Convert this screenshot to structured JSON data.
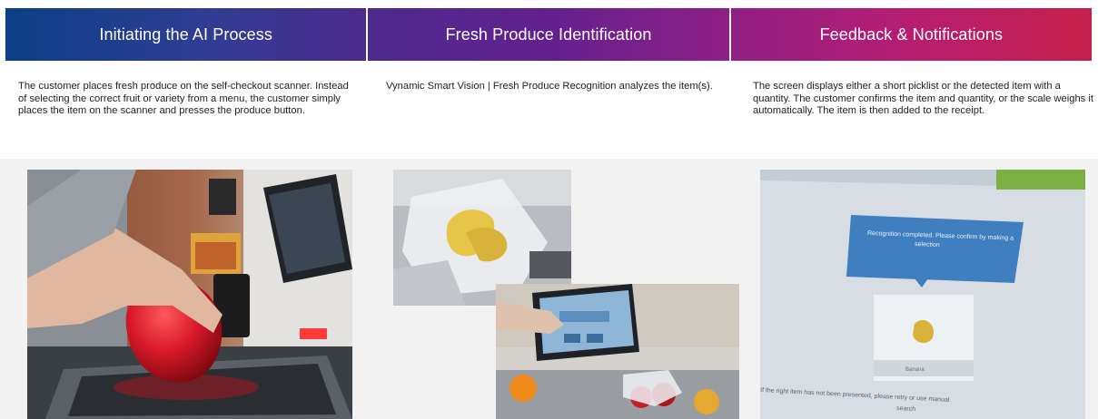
{
  "columns": [
    {
      "title": "Initiating the AI Process",
      "description": "The customer places fresh produce on the self-checkout scanner. Instead of selecting the correct fruit or variety from a menu, the customer simply places the item on the scanner and presses the produce button."
    },
    {
      "title": "Fresh Produce Identification",
      "description": "Vynamic Smart Vision | Fresh Produce Recognition analyzes the item(s)."
    },
    {
      "title": "Feedback & Notifications",
      "description": "The screen displays either a short picklist or the detected item with a quantity. The customer confirms the item and quantity, or the scale weighs it automatically. The item is then added to the receipt."
    }
  ],
  "screen_photo": {
    "message": "Recognition completed. Please confirm by making a selection",
    "item_label": "Banana",
    "footer": "If the right item has not been presented, please retry or use manual search"
  },
  "colors": {
    "header_start": "#0b3f86",
    "header_mid": "#63208f",
    "header_end": "#c5204a",
    "bell_pepper": "#d8192a",
    "screen_blue": "#3f7fbf"
  }
}
